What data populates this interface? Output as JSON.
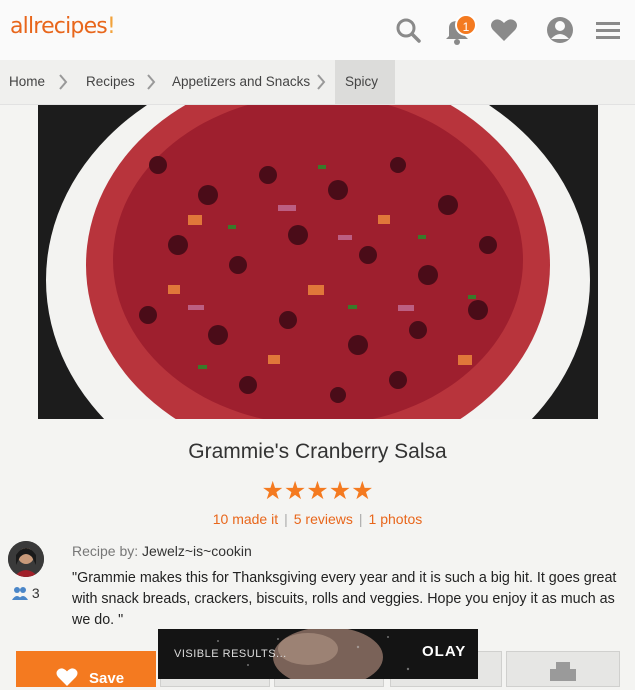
{
  "header": {
    "logo": "allrecipes",
    "notification_count": "1",
    "icons": [
      "search-icon",
      "bell-icon",
      "heart-icon",
      "profile-icon",
      "menu-icon"
    ]
  },
  "breadcrumb": [
    "Home",
    "Recipes",
    "Appetizers and Snacks",
    "Spicy"
  ],
  "recipe": {
    "title": "Grammie's Cranberry Salsa",
    "stars": "★★★★★",
    "rating": 5,
    "made_it": "10 made it",
    "reviews": "5 reviews",
    "photos": "1 photos",
    "by_label": "Recipe by:",
    "author": "Jewelz~is~cookin",
    "followers": "3",
    "description": "\"Grammie makes this for Thanksgiving every year and it is such a big hit. It goes great with snack breads, crackers, biscuits, rolls and veggies. Hope you enjoy it as much as we do. \""
  },
  "actions": {
    "save_label": "Save"
  },
  "ad": {
    "text": "VISIBLE RESULTS...",
    "brand": "OLAY"
  },
  "colors": {
    "accent": "#f47a20",
    "link": "#e8661b"
  }
}
